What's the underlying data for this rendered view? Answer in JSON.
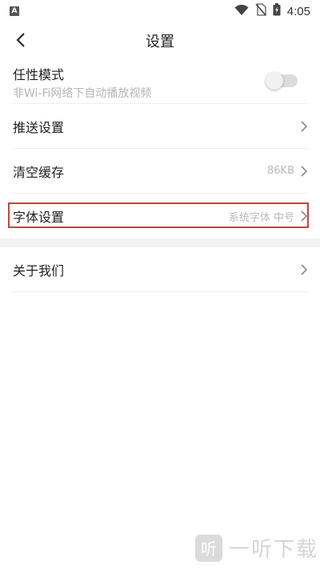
{
  "status_bar": {
    "app_badge": "A",
    "time": "4:05",
    "icons": [
      "wifi-icon",
      "no-sim-icon",
      "battery-charging-icon"
    ]
  },
  "header": {
    "back_icon": "chevron-left-icon",
    "title": "设置"
  },
  "settings": {
    "items": [
      {
        "label": "任性模式",
        "sublabel": "非Wi-Fi网络下自动播放视频",
        "control": "toggle",
        "toggle_on": false
      },
      {
        "label": "推送设置",
        "value": "",
        "icon": "chevron-right-icon"
      },
      {
        "label": "清空缓存",
        "value": "86KB",
        "icon": "chevron-right-icon"
      },
      {
        "label": "字体设置",
        "value": "系统字体 中号",
        "icon": "chevron-right-icon",
        "highlighted": true
      },
      {
        "label": "关于我们",
        "value": "",
        "icon": "chevron-right-icon"
      }
    ]
  },
  "watermark": {
    "icon_glyph": "听",
    "text": "一听下载"
  },
  "colors": {
    "highlight": "#d93a3a",
    "divider": "#eeeeee",
    "secondary_text": "#b5b5b5"
  }
}
